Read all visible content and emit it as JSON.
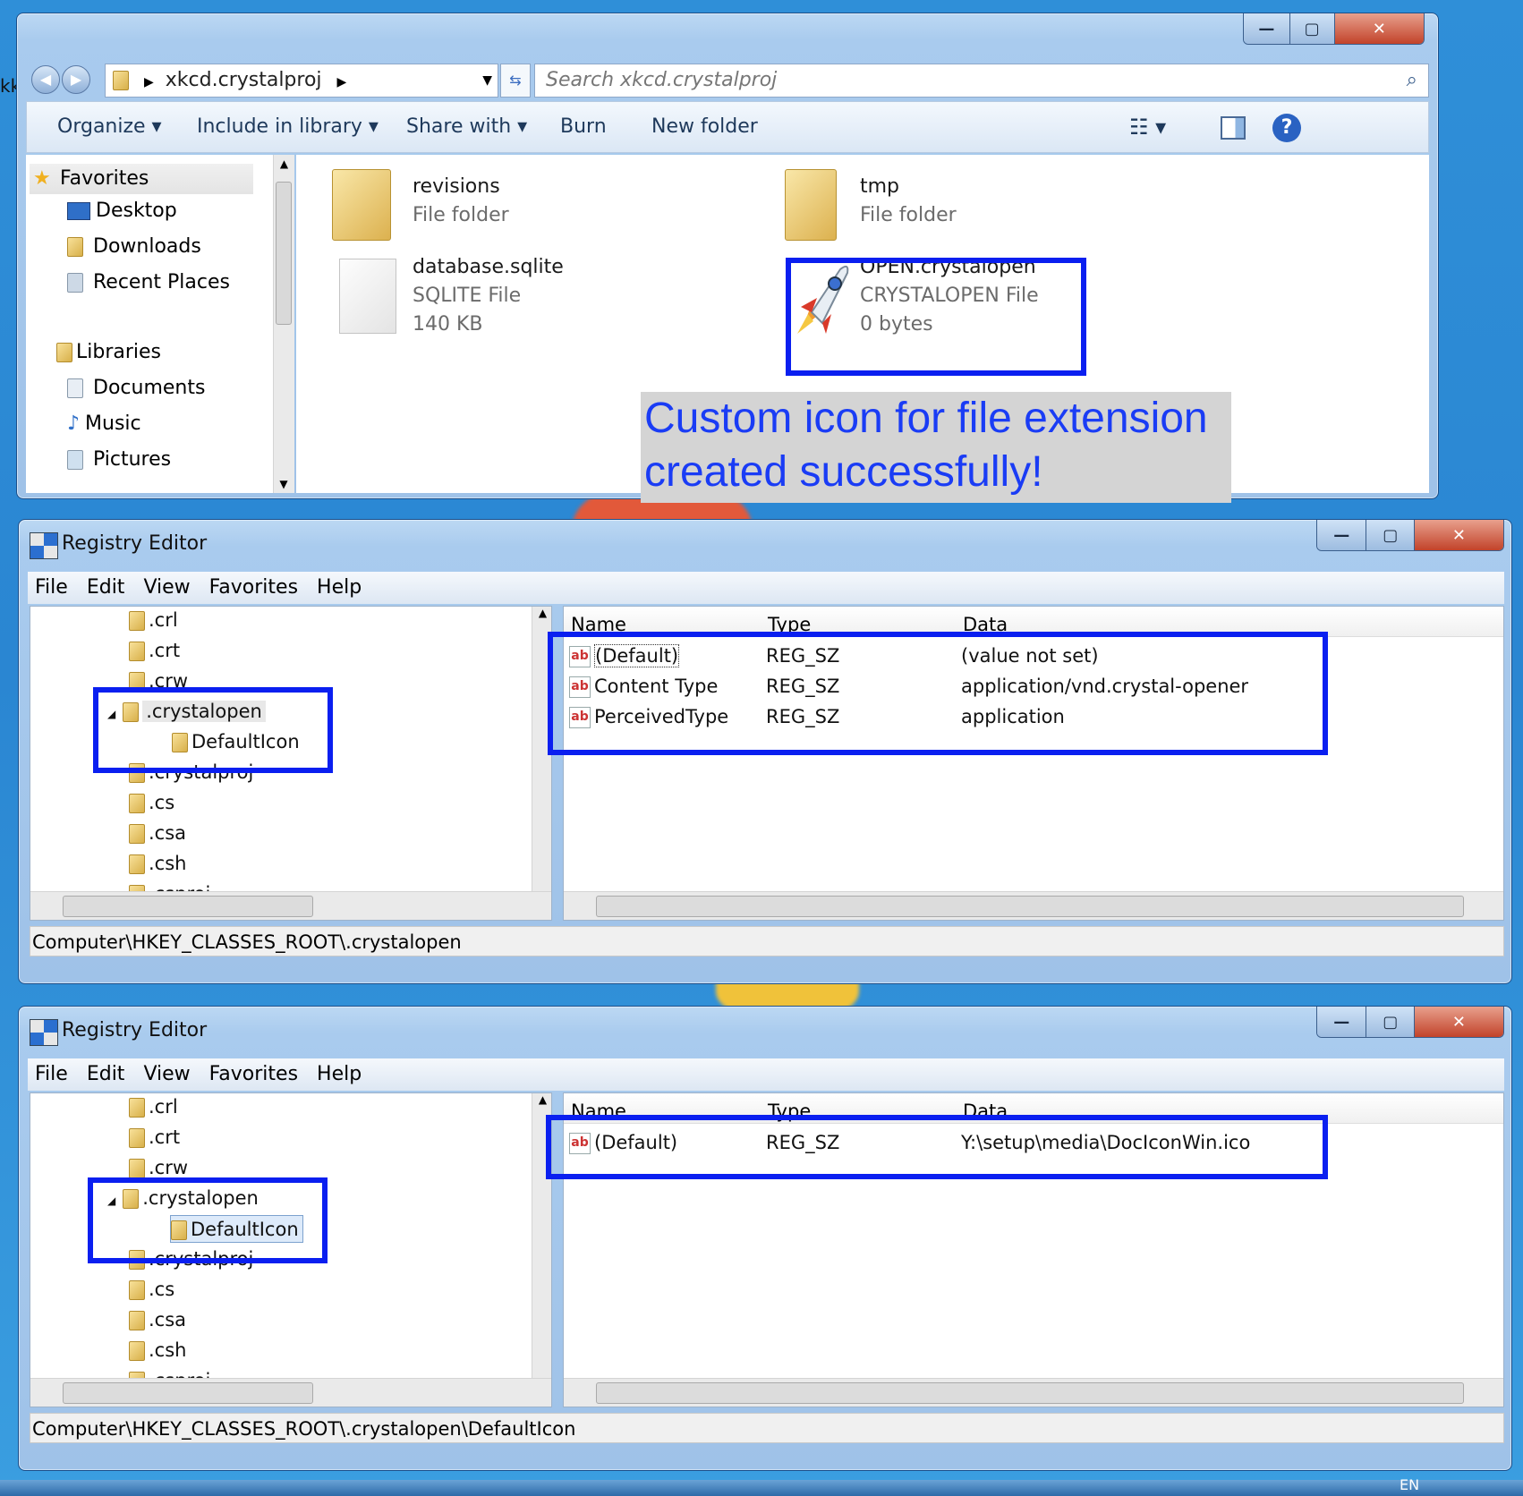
{
  "explorer": {
    "breadcrumb": "xkcd.crystalproj",
    "search_placeholder": "Search xkcd.crystalproj",
    "toolbar": {
      "organize": "Organize",
      "include": "Include in library",
      "share": "Share with",
      "burn": "Burn",
      "new_folder": "New folder"
    },
    "nav": {
      "favorites": "Favorites",
      "desktop": "Desktop",
      "downloads": "Downloads",
      "recent": "Recent Places",
      "libraries": "Libraries",
      "documents": "Documents",
      "music": "Music",
      "pictures": "Pictures"
    },
    "files": [
      {
        "name": "revisions",
        "type": "File folder",
        "size": ""
      },
      {
        "name": "tmp",
        "type": "File folder",
        "size": ""
      },
      {
        "name": "database.sqlite",
        "type": "SQLITE File",
        "size": "140 KB"
      },
      {
        "name": "OPEN.crystalopen",
        "type": "CRYSTALOPEN File",
        "size": "0 bytes"
      }
    ],
    "left_edge_text": "kk"
  },
  "annotation": {
    "line1": "Custom icon for file extension",
    "line2": "created successfully!"
  },
  "regedit1": {
    "title": "Registry Editor",
    "menu": [
      "File",
      "Edit",
      "View",
      "Favorites",
      "Help"
    ],
    "tree": [
      ".crl",
      ".crt",
      ".crw",
      ".crystalopen",
      "DefaultIcon",
      ".crystalproj",
      ".cs",
      ".csa",
      ".csh",
      ".csproj"
    ],
    "headers": [
      "Name",
      "Type",
      "Data"
    ],
    "values": [
      {
        "name": "(Default)",
        "type": "REG_SZ",
        "data": "(value not set)"
      },
      {
        "name": "Content Type",
        "type": "REG_SZ",
        "data": "application/vnd.crystal-opener"
      },
      {
        "name": "PerceivedType",
        "type": "REG_SZ",
        "data": "application"
      }
    ],
    "status": "Computer\\HKEY_CLASSES_ROOT\\.crystalopen"
  },
  "regedit2": {
    "title": "Registry Editor",
    "menu": [
      "File",
      "Edit",
      "View",
      "Favorites",
      "Help"
    ],
    "tree": [
      ".crl",
      ".crt",
      ".crw",
      ".crystalopen",
      "DefaultIcon",
      ".crystalproj",
      ".cs",
      ".csa",
      ".csh",
      ".csproj"
    ],
    "headers": [
      "Name",
      "Type",
      "Data"
    ],
    "values": [
      {
        "name": "(Default)",
        "type": "REG_SZ",
        "data": "Y:\\setup\\media\\DocIconWin.ico"
      }
    ],
    "status": "Computer\\HKEY_CLASSES_ROOT\\.crystalopen\\DefaultIcon"
  },
  "taskbar": {
    "lang": "EN"
  },
  "colors": {
    "highlight_box": "#0a1ff0",
    "annotation_text": "#1a3cf5",
    "annotation_bg": "#d4d4d4"
  }
}
